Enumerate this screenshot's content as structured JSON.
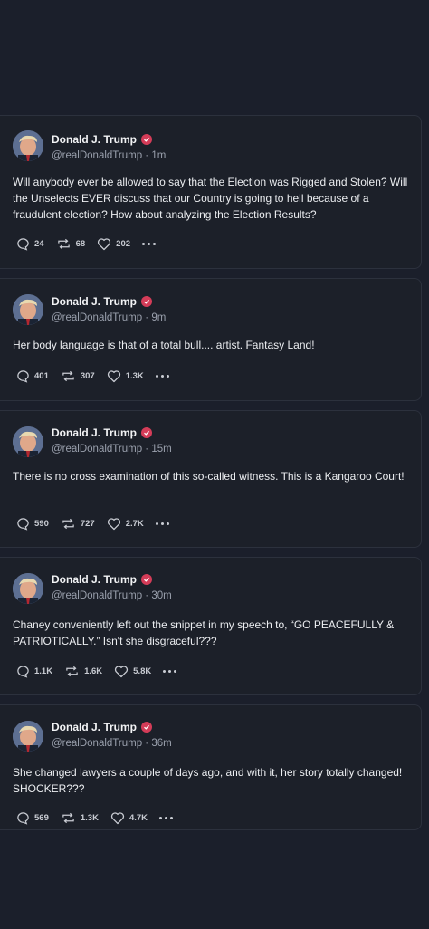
{
  "posts": [
    {
      "author": "Donald J. Trump",
      "handle": "@realDonaldTrump",
      "time": "1m",
      "text": "Will anybody ever be allowed to say that the Election was Rigged and Stolen? Will the Unselects EVER discuss that our Country is going to hell because of a fraudulent election? How about analyzing the Election Results?",
      "replies": "24",
      "retruths": "68",
      "likes": "202"
    },
    {
      "author": "Donald J. Trump",
      "handle": "@realDonaldTrump",
      "time": "9m",
      "text": "Her body language is that of a total bull.... artist. Fantasy Land!",
      "replies": "401",
      "retruths": "307",
      "likes": "1.3K"
    },
    {
      "author": "Donald J. Trump",
      "handle": "@realDonaldTrump",
      "time": "15m",
      "text": "There is no cross examination of this so-called witness. This is a Kangaroo Court!",
      "replies": "590",
      "retruths": "727",
      "likes": "2.7K"
    },
    {
      "author": "Donald J. Trump",
      "handle": "@realDonaldTrump",
      "time": "30m",
      "text": "Chaney conveniently left out the snippet in my speech to, “GO PEACEFULLY & PATRIOTICALLY.” Isn't she disgraceful???",
      "replies": "1.1K",
      "retruths": "1.6K",
      "likes": "5.8K"
    },
    {
      "author": "Donald J. Trump",
      "handle": "@realDonaldTrump",
      "time": "36m",
      "text": "She changed lawyers a couple of days ago, and with it, her story totally changed! SHOCKER???",
      "replies": "569",
      "retruths": "1.3K",
      "likes": "4.7K"
    }
  ],
  "separator": " · ",
  "colors": {
    "background": "#1b1f2b",
    "card": "#1c2029",
    "verified_badge": "#d43c58",
    "muted_text": "#9aa0ad"
  },
  "icons": {
    "reply": "speech-bubble-icon",
    "retruth": "repost-arrows-icon",
    "like": "heart-icon",
    "more": "ellipsis-icon",
    "verified": "verified-badge-icon"
  }
}
